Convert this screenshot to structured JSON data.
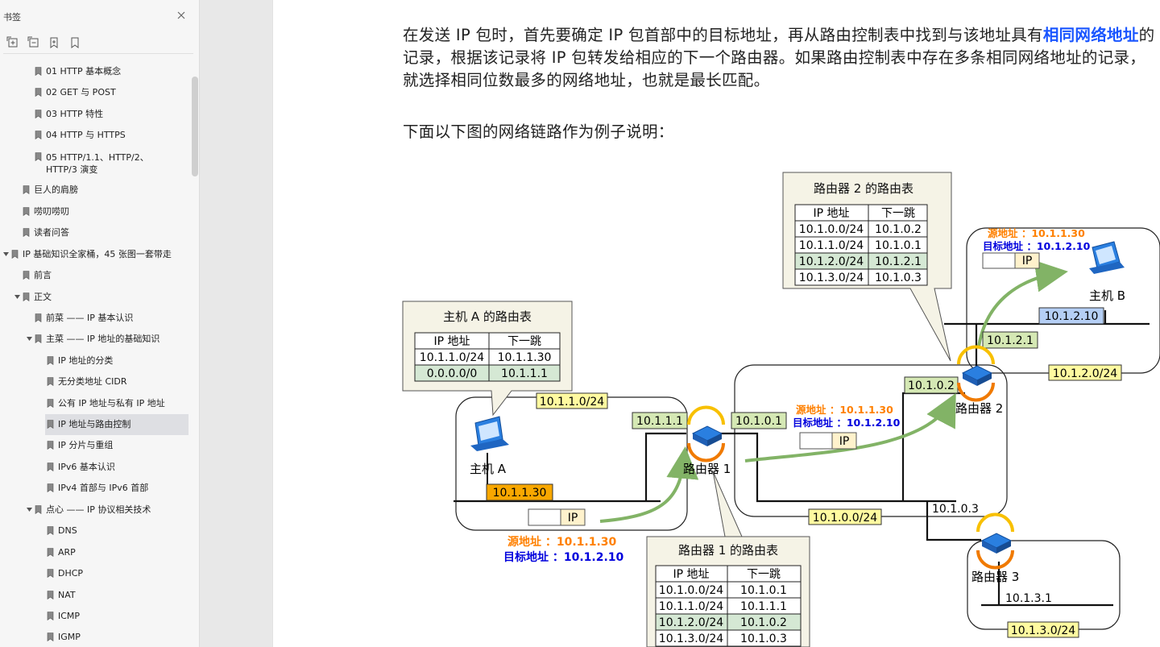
{
  "sidebar": {
    "title": "书签",
    "tools": [
      "expand-all-icon",
      "collapse-all-icon",
      "add-bookmark-icon",
      "bookmark-icon"
    ],
    "items": [
      {
        "label": "01 HTTP 基本概念",
        "level": 2
      },
      {
        "label": "02 GET 与 POST",
        "level": 2
      },
      {
        "label": "03 HTTP 特性",
        "level": 2
      },
      {
        "label": "04 HTTP 与 HTTPS",
        "level": 2
      },
      {
        "label": "05 HTTP/1.1、HTTP/2、HTTP/3 演变",
        "level": 2
      },
      {
        "label": "巨人的肩膀",
        "level": 1
      },
      {
        "label": "唠叨唠叨",
        "level": 1
      },
      {
        "label": "读者问答",
        "level": 1
      },
      {
        "label": "IP 基础知识全家桶，45 张图一套带走",
        "level": 0
      },
      {
        "label": "前言",
        "level": 1
      },
      {
        "label": "正文",
        "level": 1
      },
      {
        "label": "前菜 —— IP 基本认识",
        "level": 2
      },
      {
        "label": "主菜 —— IP 地址的基础知识",
        "level": 2
      },
      {
        "label": "IP 地址的分类",
        "level": 3
      },
      {
        "label": "无分类地址 CIDR",
        "level": 3
      },
      {
        "label": "公有 IP 地址与私有 IP 地址",
        "level": 3
      },
      {
        "label": "IP 地址与路由控制",
        "level": 3,
        "selected": true
      },
      {
        "label": "IP 分片与重组",
        "level": 3
      },
      {
        "label": "IPv6 基本认识",
        "level": 3
      },
      {
        "label": "IPv4 首部与 IPv6 首部",
        "level": 3
      },
      {
        "label": "点心 —— IP 协议相关技术",
        "level": 2
      },
      {
        "label": "DNS",
        "level": 3
      },
      {
        "label": "ARP",
        "level": 3
      },
      {
        "label": "DHCP",
        "level": 3
      },
      {
        "label": "NAT",
        "level": 3
      },
      {
        "label": "ICMP",
        "level": 3
      },
      {
        "label": "IGMP",
        "level": 3
      }
    ]
  },
  "content": {
    "para1_a": "在发送 IP 包时，首先要确定 IP 包首部中的目标地址，再从路由控制表中找到与该地址具有",
    "para1_hl": "相同网络地址",
    "para1_b": "的记录，根据该记录将 IP 包转发给相应的下一个路由器。如果路由控制表中存在多条相同网络地址的记录，就选择相同位数最多的网络地址，也就是最长匹配。",
    "para2": "下面以下图的网络链路作为例子说明："
  },
  "diagram": {
    "table_headers": [
      "IP 地址",
      "下一跳"
    ],
    "host_a_table": {
      "title": "主机 A 的路由表",
      "rows": [
        [
          "10.1.1.0/24",
          "10.1.1.30"
        ],
        [
          "0.0.0.0/0",
          "10.1.1.1"
        ]
      ]
    },
    "router1_table": {
      "title": "路由器 1 的路由表",
      "rows": [
        [
          "10.1.0.0/24",
          "10.1.0.1"
        ],
        [
          "10.1.1.0/24",
          "10.1.1.1"
        ],
        [
          "10.1.2.0/24",
          "10.1.0.2"
        ],
        [
          "10.1.3.0/24",
          "10.1.0.3"
        ]
      ]
    },
    "router2_table": {
      "title": "路由器 2 的路由表",
      "rows": [
        [
          "10.1.0.0/24",
          "10.1.0.2"
        ],
        [
          "10.1.1.0/24",
          "10.1.0.1"
        ],
        [
          "10.1.2.0/24",
          "10.1.2.1"
        ],
        [
          "10.1.3.0/24",
          "10.1.0.3"
        ]
      ]
    },
    "host_a_label": "主机 A",
    "host_b_label": "主机 B",
    "router1_label": "路由器 1",
    "router2_label": "路由器 2",
    "router3_label": "路由器 3",
    "addr_host_a": "10.1.1.30",
    "addr_host_b": "10.1.2.10",
    "addr_r1_left": "10.1.1.1",
    "addr_r1_right": "10.1.0.1",
    "addr_r2_bottom": "10.1.0.2",
    "addr_r2_top": "10.1.2.1",
    "addr_r3": "10.1.0.3",
    "addr_r3_net": "10.1.3.1",
    "net_1": "10.1.1.0/24",
    "net_0": "10.1.0.0/24",
    "net_2": "10.1.2.0/24",
    "net_3": "10.1.3.0/24",
    "packet_label": "IP",
    "src_label": "源地址 ：10.1.1.30",
    "dst_label": "目标地址 ：10.1.2.10",
    "colors": {
      "yellow_label": "#fffaa0",
      "green_label": "#d5e8b4",
      "orange_label": "#f8a700",
      "blue_label": "#b5cff5",
      "table_green": "#d5e8d4",
      "callout_bg": "#f5f3e6",
      "arrow_green": "#82b366",
      "src_orange": "#ff8000",
      "dst_blue": "#0000dd"
    }
  }
}
